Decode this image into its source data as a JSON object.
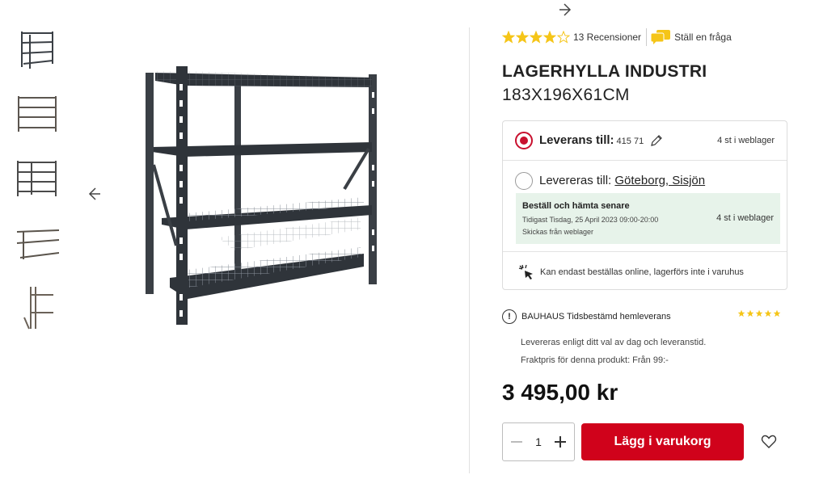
{
  "colors": {
    "accent": "#d0021b",
    "star": "#f5c518",
    "pickup_bg": "#e7f3ea"
  },
  "gallery": {
    "thumbnails": [
      "shelf-front-view",
      "shelf-side-view",
      "shelf-angle-view",
      "shelf-detail-view",
      "shelf-upright-detail"
    ],
    "prev_icon": "chevron-left-icon",
    "next_icon": "chevron-right-icon"
  },
  "product": {
    "rating": 4,
    "rating_max": 5,
    "reviews_label": "13 Recensioner",
    "ask_label": "Ställ en fråga",
    "title_line1": "LAGERHYLLA INDUSTRI",
    "title_line2": "183X196X61CM",
    "price": "3 495,00 kr"
  },
  "delivery": {
    "home": {
      "label": "Leverans till:",
      "zip": "415 71",
      "stock": "4 st i weblager",
      "selected": true
    },
    "store": {
      "label": "Levereras till:",
      "store_name": "Göteborg, Sisjön",
      "selected": false,
      "pickup_title": "Beställ och hämta senare",
      "pickup_earliest": "Tidigast Tisdag, 25 April 2023 09:00-20:00",
      "pickup_source": "Skickas från weblager",
      "stock": "4 st i weblager"
    },
    "online_only": "Kan endast beställas online, lagerförs inte i varuhus"
  },
  "bauhaus_delivery": {
    "title": "BAUHAUS Tidsbestämd hemleverans",
    "stars": 5,
    "text1": "Levereras enligt ditt val av dag och leveranstid.",
    "text2": "Fraktpris för denna produkt: Från 99:-"
  },
  "cart": {
    "quantity": "1",
    "add_label": "Lägg i varukorg"
  }
}
